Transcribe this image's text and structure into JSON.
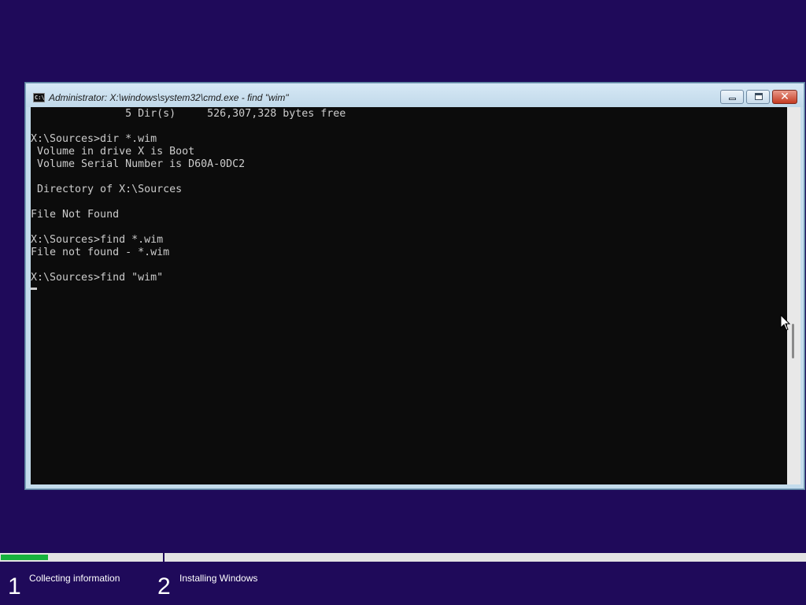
{
  "window": {
    "title": "Administrator: X:\\windows\\system32\\cmd.exe - find  \"wim\"",
    "icon": "cmd-icon",
    "icon_text": "C:\\"
  },
  "console": {
    "lines": [
      "               5 Dir(s)     526,307,328 bytes free",
      "",
      "X:\\Sources>dir *.wim",
      " Volume in drive X is Boot",
      " Volume Serial Number is D60A-0DC2",
      "",
      " Directory of X:\\Sources",
      "",
      "File Not Found",
      "",
      "X:\\Sources>find *.wim",
      "File not found - *.wim",
      "",
      "X:\\Sources>find \"wim\""
    ],
    "colors": {
      "background": "#0c0c0c",
      "foreground": "#cccccc"
    }
  },
  "setup": {
    "progress": 0.29,
    "steps": [
      {
        "number": "1",
        "label": "Collecting information"
      },
      {
        "number": "2",
        "label": "Installing Windows"
      }
    ],
    "colors": {
      "background": "#1f0a5a",
      "progress": "#17b23e"
    }
  }
}
